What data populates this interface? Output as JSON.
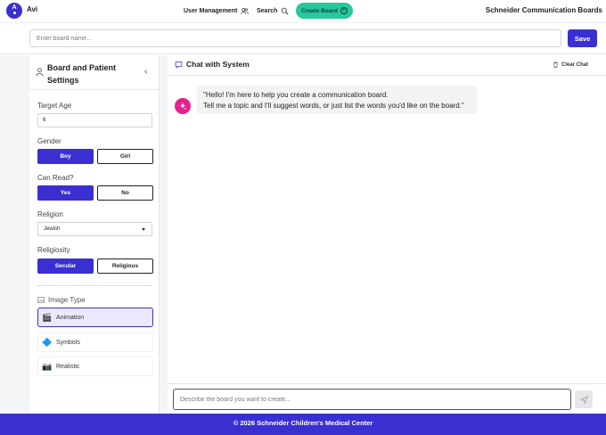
{
  "header": {
    "avatar_initial": "A",
    "username": "Avi",
    "user_management": "User Management",
    "search": "Search",
    "create_board": "Create Board",
    "app_title": "Schneider Communication Boards"
  },
  "board": {
    "name_placeholder": "Enter board name...",
    "save_label": "Save"
  },
  "settings": {
    "title": "Board and Patient Settings",
    "target_age_label": "Target Age",
    "target_age_value": "6",
    "gender_label": "Gender",
    "gender_options": [
      "Boy",
      "Girl"
    ],
    "gender_selected": "Boy",
    "can_read_label": "Can Read?",
    "can_read_options": [
      "Yes",
      "No"
    ],
    "can_read_selected": "Yes",
    "religion_label": "Religion",
    "religion_value": "Jewish",
    "religiosity_label": "Religiosity",
    "religiosity_options": [
      "Secular",
      "Religious"
    ],
    "religiosity_selected": "Secular",
    "image_type_label": "Image Type",
    "image_types": [
      {
        "label": "Animation",
        "icon": "clapperboard-icon",
        "glyph": "🎬"
      },
      {
        "label": "Symbols",
        "icon": "blue-diamond-icon",
        "glyph": "🔷"
      },
      {
        "label": "Realistic",
        "icon": "camera-icon",
        "glyph": "📷"
      }
    ],
    "image_type_selected": "Animation"
  },
  "chat": {
    "title": "Chat with System",
    "clear_label": "Clear Chat",
    "message_line1": "\"Hello! I'm here to help you create a communication board.",
    "message_line2": "Tell me a topic and I'll suggest words, or just list the words you'd like on the board.\"",
    "input_placeholder": "Describe the board you want to create..."
  },
  "footer": {
    "text": "© 2026 Schneider Children's Medical Center"
  },
  "colors": {
    "accent": "#3a2fd1",
    "create_button": "#26c99a",
    "bot_avatar": "#e91e8c"
  }
}
